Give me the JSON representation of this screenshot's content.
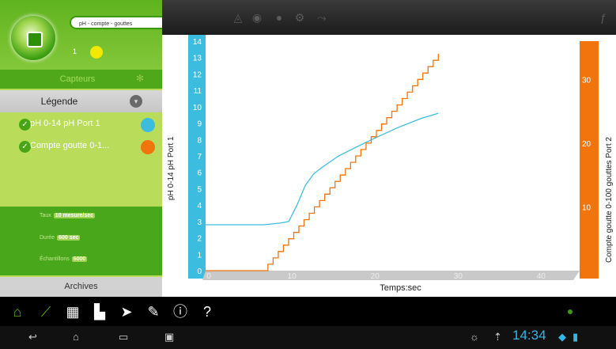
{
  "app": {
    "title": "pH - compte - gouttes",
    "count": "1"
  },
  "sidebar": {
    "sensors_label": "Capteurs",
    "legend_label": "Légende",
    "legend_items": [
      {
        "label": "pH 0-14 pH Port 1",
        "color": "#3cbde0"
      },
      {
        "label": "Compte goutte 0-1...",
        "color": "#f2740d"
      }
    ],
    "params": {
      "rate_label": "Taux",
      "rate_value": "10 mesure/sec",
      "duration_label": "Durée",
      "duration_value": "600 sec",
      "samples_label": "Échantillons",
      "samples_value": "6000"
    },
    "archives_label": "Archives"
  },
  "toolbar": {
    "icons": [
      "chart-icon",
      "camera-icon",
      "record-icon",
      "settings-icon",
      "share-icon"
    ],
    "right_icon": "fx-icon"
  },
  "colors": {
    "ph": "#3cbde0",
    "drops": "#f2740d",
    "green": "#48a71a"
  },
  "chart_data": {
    "type": "line",
    "xlabel": "Temps:sec",
    "x_ticks": [
      "0",
      "10",
      "20",
      "30",
      "40"
    ],
    "xlim": [
      0,
      45
    ],
    "left_axis": {
      "label": "pH 0-14 pH Port 1",
      "ticks": [
        "0",
        "1",
        "2",
        "3",
        "4",
        "5",
        "6",
        "7",
        "8",
        "9",
        "10",
        "11",
        "12",
        "13",
        "14"
      ],
      "ylim": [
        0,
        14
      ]
    },
    "right_axis": {
      "label": "Compte goutte 0-100 gouttes Port 2",
      "ticks": [
        "10",
        "20",
        "30"
      ],
      "ylim": [
        0,
        36
      ]
    },
    "series": [
      {
        "axis": "left",
        "color": "#3cbde0",
        "x": [
          0,
          7,
          9,
          10,
          11,
          12,
          13,
          14,
          16,
          18,
          20,
          23,
          26,
          28
        ],
        "y": [
          2.8,
          2.8,
          2.9,
          3.0,
          4.0,
          5.2,
          5.9,
          6.3,
          7.0,
          7.5,
          8.0,
          8.7,
          9.3,
          9.6
        ]
      },
      {
        "axis": "right",
        "color": "#f2740d",
        "x": [
          0,
          7,
          7.5,
          28
        ],
        "y": [
          0,
          0,
          1,
          33.5
        ]
      }
    ]
  },
  "nav": {
    "icons": [
      "home-icon",
      "graph-icon",
      "table-icon",
      "bar-chart-icon",
      "compass-icon",
      "pen-icon",
      "info-icon",
      "help-icon"
    ]
  },
  "status": {
    "time": "14:34"
  }
}
